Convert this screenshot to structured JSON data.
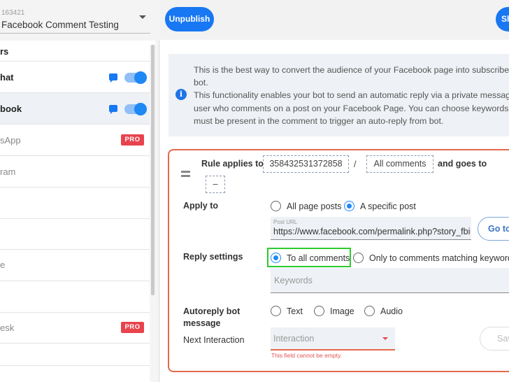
{
  "sidebar": {
    "page_selector": {
      "page_id": "163421",
      "page_name": "Facebook Comment Testing"
    },
    "section_header": "rs",
    "channels": [
      {
        "label": "hat",
        "bold": true,
        "chat_icon": "chat-icon",
        "toggle_on": true,
        "pro": false,
        "active": false
      },
      {
        "label": "book",
        "bold": true,
        "chat_icon": "chat-icon",
        "toggle_on": true,
        "pro": false,
        "active": true
      },
      {
        "label": "sApp",
        "bold": false,
        "pro": true
      },
      {
        "label": "ram",
        "bold": false,
        "pro": false
      },
      {
        "label": "",
        "bold": false,
        "pro": false
      },
      {
        "label": "",
        "bold": false,
        "pro": false
      },
      {
        "label": "e",
        "bold": false,
        "pro": false
      },
      {
        "label": "",
        "bold": false,
        "pro": false
      },
      {
        "label": "esk",
        "bold": false,
        "pro": true
      },
      {
        "label": "",
        "bold": false,
        "pro": false
      }
    ],
    "pro_badge_label": "PRO"
  },
  "toolbar": {
    "unpublish_label": "Unpublish",
    "right_button_label": "Sh"
  },
  "info": {
    "icon": "info-icon",
    "line1": "This is the best way to convert the audience of your Facebook page into subscribe",
    "line2": "bot.",
    "line3": "This functionality enables your bot to send an automatic reply via a private messag",
    "line4": "user who comments on a post on your Facebook Page. You can choose keywords",
    "line5": "must be present in the comment to trigger an auto-reply from bot."
  },
  "rule": {
    "prefix": "Rule applies to",
    "post_id": "358432531372858",
    "separator": "/",
    "comment_filter": "All comments",
    "goes_to": "and goes to",
    "destination": "–",
    "apply_to": {
      "label": "Apply to",
      "options": [
        "All page posts",
        "A specific post"
      ],
      "selected": "A specific post"
    },
    "post_url": {
      "label": "Post URL",
      "value": "https://www.facebook.com/permalink.php?story_fbid="
    },
    "goto_label": "Go to",
    "reply_settings": {
      "label": "Reply settings",
      "options": [
        "To all comments",
        "Only to comments matching keywords"
      ],
      "selected": "To all comments"
    },
    "keywords_placeholder": "Keywords",
    "autoreply": {
      "label_line1": "Autoreply bot",
      "label_line2": "message",
      "options": [
        "Text",
        "Image",
        "Audio"
      ],
      "selected": null
    },
    "next_interaction": {
      "label": "Next Interaction",
      "placeholder": "Interaction",
      "error": "This field cannot be empty."
    },
    "save_label": "Sav"
  },
  "colors": {
    "primary": "#1877f2",
    "error": "#e4694c",
    "highlight": "#2ccc2c",
    "pro_badge": "#e8434d"
  }
}
